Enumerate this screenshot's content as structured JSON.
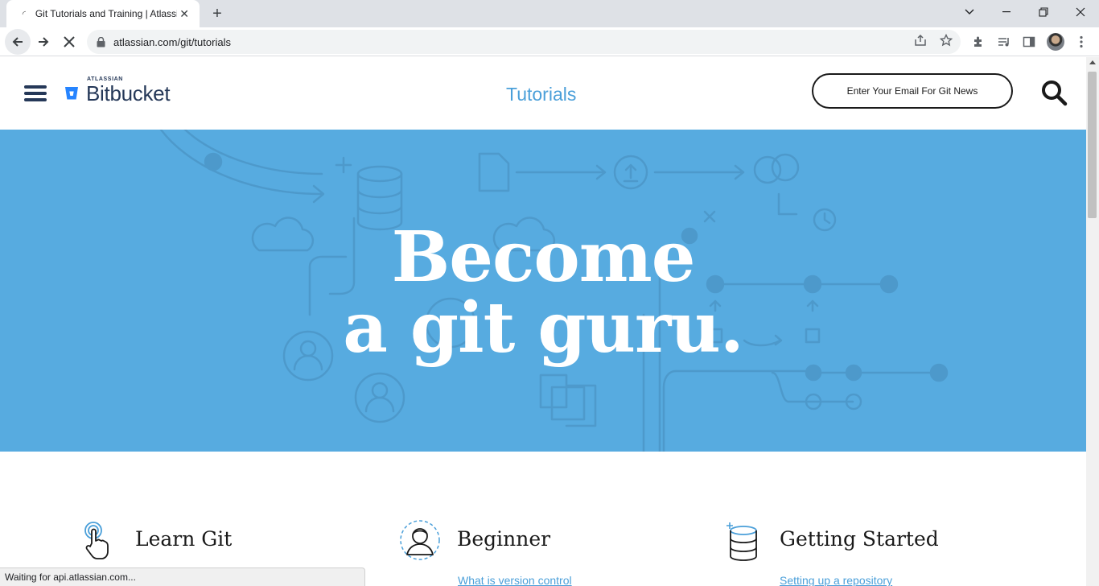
{
  "browser": {
    "tab_title": "Git Tutorials and Training | Atlassian",
    "url": "atlassian.com/git/tutorials",
    "status_text": "Waiting for api.atlassian.com..."
  },
  "header": {
    "logo_small": "ATLASSIAN",
    "logo_main": "Bitbucket",
    "nav_label": "Tutorials",
    "email_button": "Enter Your Email For Git News"
  },
  "hero": {
    "line1": "Become",
    "line2": "a git guru.",
    "background_color": "#57abe0"
  },
  "categories": [
    {
      "title": "Learn Git",
      "icon": "touch-hand-icon",
      "link": ""
    },
    {
      "title": "Beginner",
      "icon": "person-icon",
      "link": "What is version control"
    },
    {
      "title": "Getting Started",
      "icon": "database-icon",
      "link": "Setting up a repository"
    }
  ],
  "colors": {
    "accent": "#4a9fd9",
    "brand_dark": "#253858",
    "bitbucket_blue": "#2684ff"
  }
}
